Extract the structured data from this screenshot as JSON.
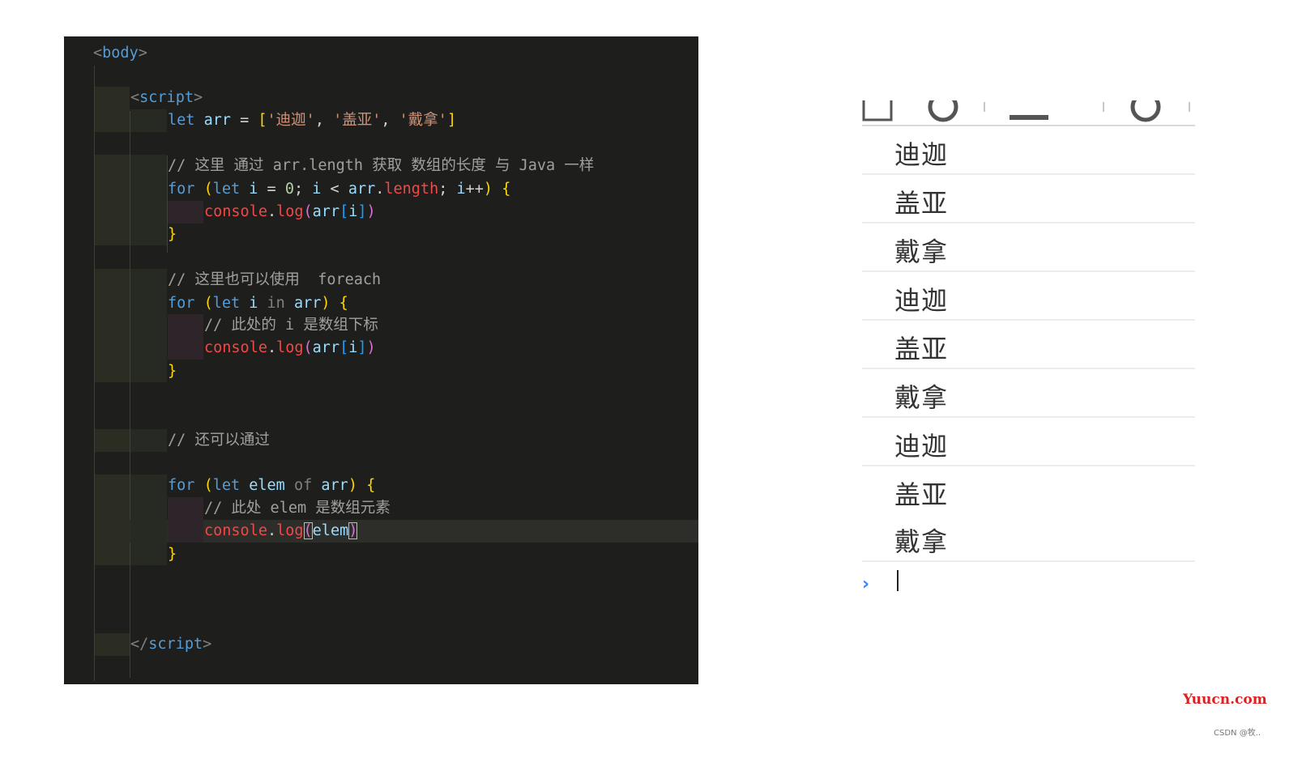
{
  "editor": {
    "lines": {
      "body_open": "body",
      "script_open": "script",
      "script_close": "script",
      "decl_kw": "let",
      "decl_var": "arr",
      "decl_str1": "'迪迦'",
      "decl_str2": "'盖亚'",
      "decl_str3": "'戴拿'",
      "comment1": "// 这里 通过 arr.length 获取 数组的长度 与 Java 一样",
      "comment2": "// 这里也可以使用  foreach",
      "comment3": "// 此处的 i 是数组下标",
      "comment4": "// 还可以通过",
      "comment5": "// 此处 elem 是数组元素",
      "kw_for": "for",
      "kw_let": "let",
      "kw_in": "in",
      "kw_of": "of",
      "var_i": "i",
      "var_elem": "elem",
      "num_zero": "0",
      "prop_length": "length",
      "console": "console",
      "log": "log"
    }
  },
  "console": {
    "logs": [
      "迪迦",
      "盖亚",
      "戴拿",
      "迪迦",
      "盖亚",
      "戴拿",
      "迪迦",
      "盖亚",
      "戴拿"
    ],
    "prompt_icon": "chevron-right-icon",
    "prompt_symbol": "›"
  },
  "watermark": "Yuucn.com",
  "credit": "CSDN @牧.."
}
